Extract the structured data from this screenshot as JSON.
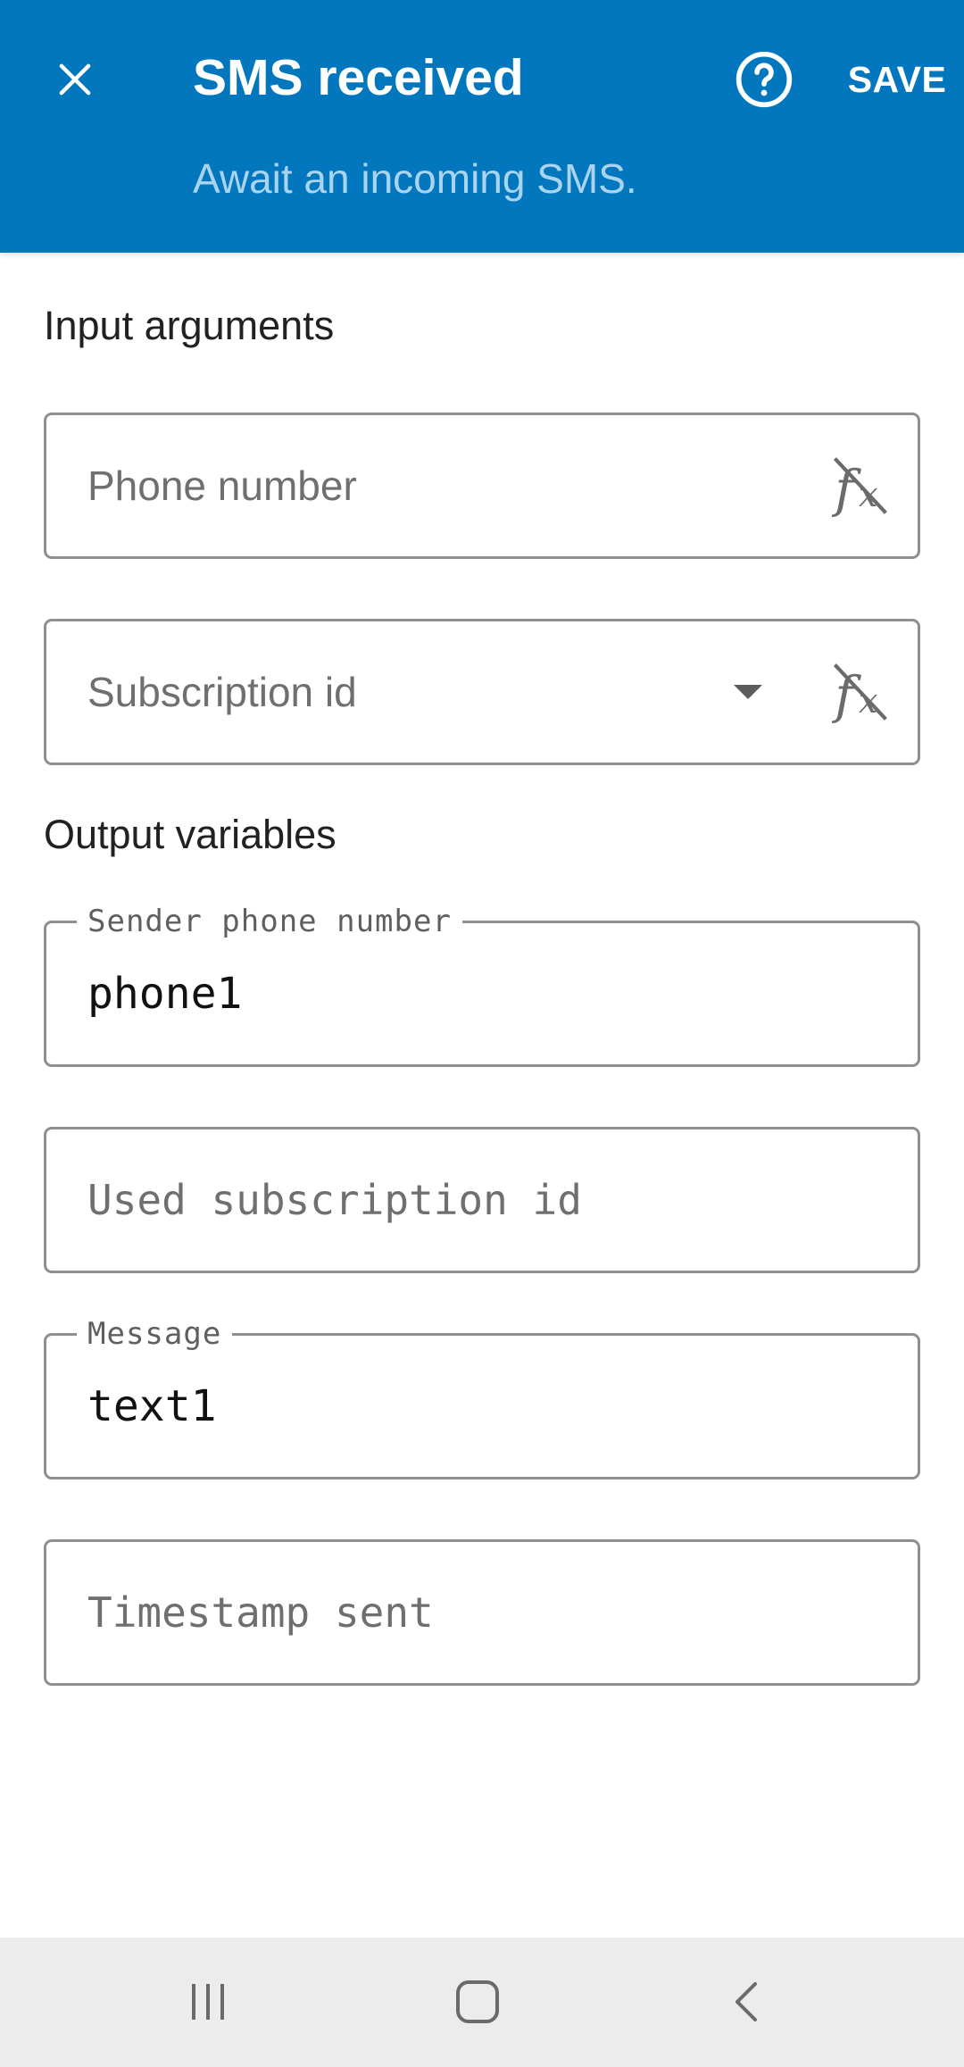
{
  "header": {
    "title": "SMS received",
    "subtitle": "Await an incoming SMS.",
    "save_label": "SAVE",
    "close_icon": "close-icon",
    "help_icon": "help-circle-icon",
    "background_color": "#0277bd"
  },
  "input_section": {
    "title": "Input arguments",
    "fields": [
      {
        "placeholder": "Phone number",
        "value": "",
        "icon": "function-off-icon"
      },
      {
        "placeholder": "Subscription id",
        "value": "",
        "icon": "function-off-icon",
        "dropdown_icon": "dropdown-arrow-icon"
      }
    ]
  },
  "output_section": {
    "title": "Output variables",
    "fields": [
      {
        "label": "Sender phone number",
        "value": "phone1"
      },
      {
        "placeholder": "Used subscription id",
        "value": ""
      },
      {
        "label": "Message",
        "value": "text1"
      },
      {
        "placeholder": "Timestamp sent",
        "value": ""
      }
    ]
  },
  "navbar": {
    "items": [
      "recents-icon",
      "home-icon",
      "back-icon"
    ]
  }
}
